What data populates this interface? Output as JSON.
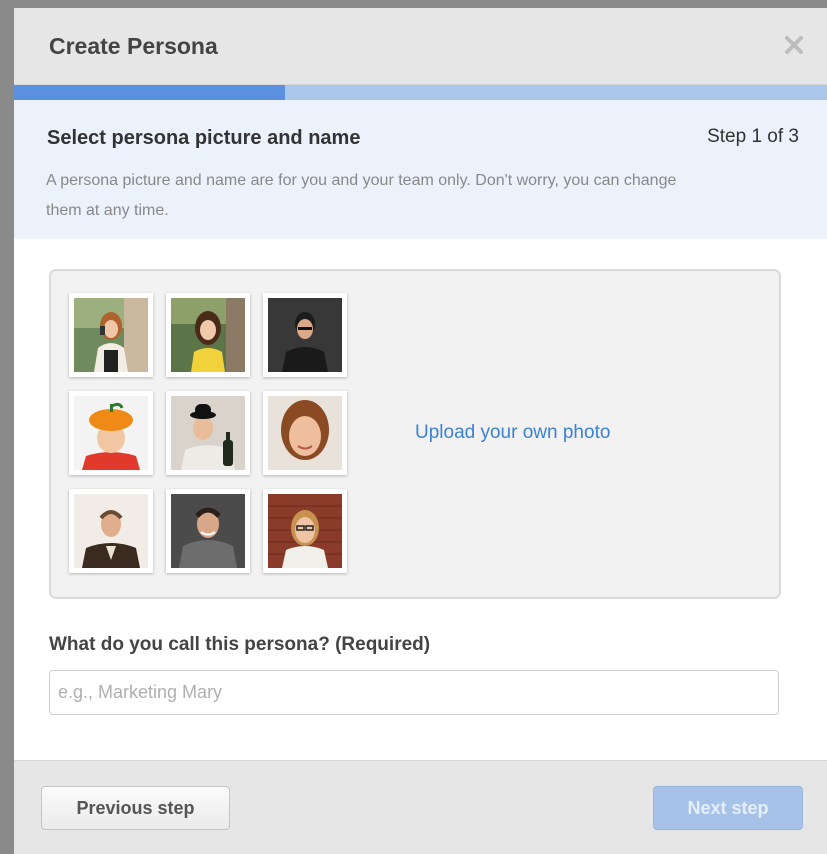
{
  "dialog": {
    "title": "Create Persona",
    "close_icon": "close-icon"
  },
  "progress": {
    "current_step": 1,
    "total_steps": 3,
    "fraction_complete": 0.333,
    "fill_color": "#5b8fe0",
    "track_color": "#a9c8ec"
  },
  "intro": {
    "heading": "Select persona picture and name",
    "step_label": "Step 1 of 3",
    "description": "A persona picture and name are for you and your team only. Don't worry, you can change them at any time."
  },
  "picker": {
    "photos": [
      {
        "name": "persona-photo-woman-phone"
      },
      {
        "name": "persona-photo-woman-yellow"
      },
      {
        "name": "persona-photo-man-dark"
      },
      {
        "name": "persona-photo-boy-pumpkin-hat"
      },
      {
        "name": "persona-photo-man-bowler-hat"
      },
      {
        "name": "persona-photo-woman-bangs"
      },
      {
        "name": "persona-photo-man-suit"
      },
      {
        "name": "persona-photo-man-hoodie"
      },
      {
        "name": "persona-photo-woman-glasses-brick"
      }
    ],
    "upload_label": "Upload your own photo"
  },
  "name_field": {
    "label": "What do you call this persona? (Required)",
    "placeholder": "e.g., Marketing Mary",
    "value": ""
  },
  "footer": {
    "previous_label": "Previous step",
    "next_label": "Next step"
  },
  "colors": {
    "link": "#3b82d4",
    "next_button_disabled": "#a7c2e8",
    "intro_background": "#ebf2fb"
  }
}
